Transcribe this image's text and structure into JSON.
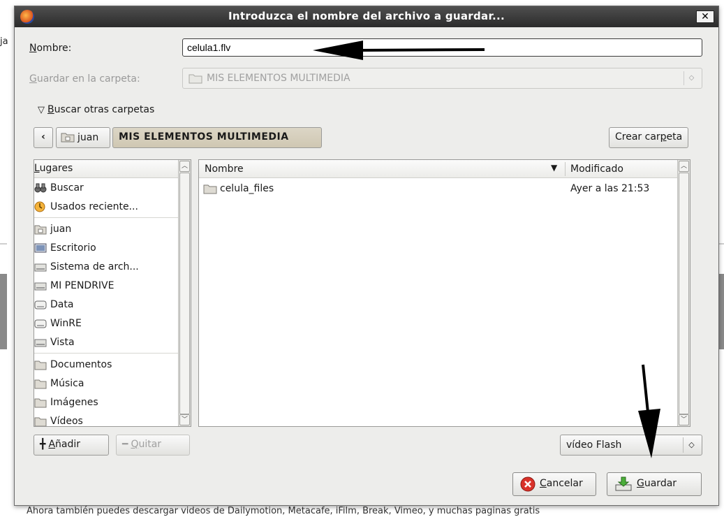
{
  "background": {
    "left_fragment": "ja",
    "bottom_text": "Ahora también puedes descargar videos de Dailymotion, Metacafe, iFilm, Break, Vimeo, y muchas paginas gratis"
  },
  "dialog": {
    "title": "Introduzca el nombre del archivo a guardar...",
    "close_glyph": "✕",
    "name_label_mnemonic": "N",
    "name_label_rest": "ombre:",
    "name_value": "celula1.flv",
    "folder_label_mnemonic": "G",
    "folder_label_rest": "uardar en la carpeta:",
    "folder_value": "MIS ELEMENTOS MULTIMEDIA",
    "expander_mnemonic": "B",
    "expander_rest": "uscar otras carpetas",
    "path_back": "‹",
    "path_items": [
      "juan",
      "MIS ELEMENTOS MULTIMEDIA"
    ],
    "new_folder_pre": "Crear car",
    "new_folder_mnemonic": "p",
    "new_folder_post": "eta",
    "places_header_mnemonic": "L",
    "places_header_rest": "ugares",
    "places": [
      {
        "label": "Buscar",
        "icon": "search-binoculars-icon"
      },
      {
        "label": "Usados reciente...",
        "icon": "recent-clock-icon"
      },
      {
        "label": "juan",
        "icon": "home-folder-icon"
      },
      {
        "label": "Escritorio",
        "icon": "desktop-icon"
      },
      {
        "label": "Sistema de arch...",
        "icon": "drive-icon"
      },
      {
        "label": "MI PENDRIVE",
        "icon": "drive-icon"
      },
      {
        "label": "Data",
        "icon": "disk-icon"
      },
      {
        "label": "WinRE",
        "icon": "disk-icon"
      },
      {
        "label": "Vista",
        "icon": "drive-icon"
      },
      {
        "label": "Documentos",
        "icon": "folder-icon"
      },
      {
        "label": "Música",
        "icon": "folder-icon"
      },
      {
        "label": "Imágenes",
        "icon": "folder-icon"
      },
      {
        "label": "Vídeos",
        "icon": "folder-icon"
      }
    ],
    "columns": {
      "name": "Nombre",
      "modified": "Modificado"
    },
    "files": [
      {
        "name": "celula_files",
        "modified": "Ayer a las 21:53"
      }
    ],
    "add_mnemonic": "A",
    "add_rest": "ñadir",
    "remove_mnemonic": "Q",
    "remove_rest": "uitar",
    "filter_value": "vídeo Flash",
    "cancel_mnemonic": "C",
    "cancel_rest": "ancelar",
    "save_mnemonic": "G",
    "save_rest": "uardar"
  },
  "colors": {
    "titlebar": "#2b2b2b",
    "dialog_bg": "#ededeb",
    "active_crumb": "#cfc7b2",
    "arrow": "#000000"
  }
}
